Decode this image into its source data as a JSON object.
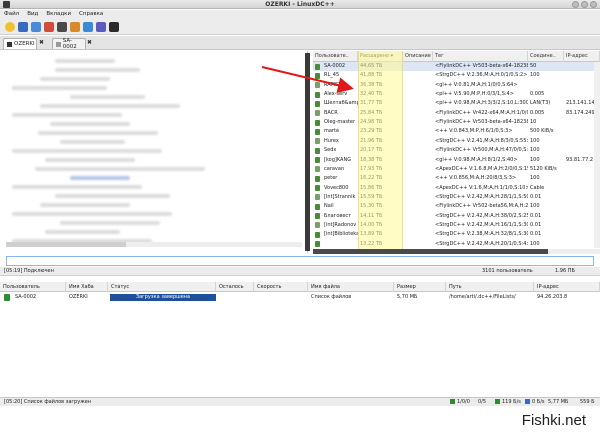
{
  "window": {
    "title": "OZERKI - LinuxDC++"
  },
  "menu": [
    "Файл",
    "Вид",
    "Вкладки",
    "Справка"
  ],
  "toolbar_icons": [
    "favorites-icon",
    "public-hubs-icon",
    "reconnect-icon",
    "settings-icon",
    "search-icon",
    "download-queue-icon",
    "finished-icon",
    "upload-icon",
    "quit-icon"
  ],
  "hub_tabs": [
    {
      "label": "OZERKI",
      "active": true
    },
    {
      "label": "SA-0002",
      "active": false
    }
  ],
  "users": {
    "columns": [
      "Пользовате..",
      "Расшарено ▾",
      "Описание",
      "Тег",
      "Соедине..",
      "IP-адрес"
    ],
    "rows": [
      {
        "nick": "SA-0002",
        "share": "44,65 ТБ",
        "desc": "",
        "tag": "<FlylinkDC++ Vr503-beta-x64-18238,M:A,H:1/0/0,S:5>",
        "conn": "50",
        "ip": ""
      },
      {
        "nick": "RL_45",
        "share": "41,88 ТБ",
        "desc": "",
        "tag": "<StrgDC++ V:2.36,M:A,H:0/1/0,S:2>",
        "conn": "100",
        "ip": ""
      },
      {
        "nick": "RAPIST",
        "share": "36,38 ТБ",
        "desc": "",
        "tag": "<gl++ V:0.81,M:A,H:1/0/0,S:64>",
        "conn": "",
        "ip": ""
      },
      {
        "nick": "Alex-serv",
        "share": "32,40 ТБ",
        "desc": "",
        "tag": "<pl++ V:5.90,M:P,H:0/3/1,S:4>",
        "conn": "0.005",
        "ip": ""
      },
      {
        "nick": "Шелтаб&amp;",
        "share": "31,77 ТБ",
        "desc": "",
        "tag": "<pl++ V:0.98,M:A,H:3/3/2,S:10,L:3000>",
        "conn": "LAN(T3)",
        "ip": "213.141.148.2"
      },
      {
        "nick": "BACR",
        "share": "25,84 ТБ",
        "desc": "",
        "tag": "<FlylinkDC++ Vr422-x64,M:A,H:1/0/0,S:2>",
        "conn": "0.005",
        "ip": "83.174.249.69"
      },
      {
        "nick": "Oleg-master",
        "share": "24,98 ТБ",
        "desc": "",
        "tag": "<FlylinkDC++ Vr503-beta-x64-18238,M:A,H:1/0/0,S:4>",
        "conn": "10",
        "ip": ""
      },
      {
        "nick": "marté",
        "share": "23,29 ТБ",
        "desc": "",
        "tag": "<++ V:0.843,M:P,H:6/1/0,S:3>",
        "conn": "500 KiB/s",
        "ip": ""
      },
      {
        "nick": "Hurex",
        "share": "21,96 ТБ",
        "desc": "",
        "tag": "<StrgDC++ V:2.41,M:A,H:8/3/0,S:55>",
        "conn": "100",
        "ip": ""
      },
      {
        "nick": "Sedx",
        "share": "20,17 ТБ",
        "desc": "",
        "tag": "<FlylinkDC++ Vr500,M:A,H:47/0/0,S:8>",
        "conn": "100",
        "ip": ""
      },
      {
        "nick": "[kog]KANG",
        "share": "18,38 ТБ",
        "desc": "",
        "tag": "<gl++ V:0.98,M:A,H:8/1/2,S:40>",
        "conn": "100",
        "ip": "93.81.77.2"
      },
      {
        "nick": "caravan",
        "share": "17,93 ТБ",
        "desc": "",
        "tag": "<ApexDC++ V:1.6.8,M:A,H:2/0/0,S:15>",
        "conn": "5120 KiB/s",
        "ip": ""
      },
      {
        "nick": "peter",
        "share": "16,22 ТБ",
        "desc": "",
        "tag": "<++ V:0.856,M:A,H:20/8/3,S:3>",
        "conn": "100",
        "ip": ""
      },
      {
        "nick": "Vovec800",
        "share": "15,86 ТБ",
        "desc": "",
        "tag": "<ApexDC++ V:1.6,M:A,H:1/1/0,S:10>",
        "conn": "Cable",
        "ip": ""
      },
      {
        "nick": "[Int]Strannik",
        "share": "15,59 ТБ",
        "desc": "",
        "tag": "<StrgDC++ V:2.42,M:A,H:28/1/1,S:50>",
        "conn": "0.01",
        "ip": ""
      },
      {
        "nick": "Nail",
        "share": "15,30 ТБ",
        "desc": "",
        "tag": "<FlylinkDC++ Vr502-beta56,M:A,H:22/0/0,S:5>",
        "conn": "100",
        "ip": ""
      },
      {
        "nick": "Благовест",
        "share": "14,11 ТБ",
        "desc": "",
        "tag": "<StrgDC++ V:2.42,M:A,H:38/0/2,S:25>",
        "conn": "0.01",
        "ip": ""
      },
      {
        "nick": "[int]Radonov",
        "share": "14,00 ТБ",
        "desc": "",
        "tag": "<StrgDC++ V:2.42,M:A,H:16/1/1,S:30>",
        "conn": "0.01",
        "ip": ""
      },
      {
        "nick": "[int]Biblioteka",
        "share": "13,89 ТБ",
        "desc": "",
        "tag": "<StrgDC++ V:2.38,M:A,H:32/8/1,S:30>",
        "conn": "0.01",
        "ip": ""
      },
      {
        "nick": "",
        "share": "13,22 ТБ",
        "desc": "",
        "tag": "<StrgDC++ V:2.42,M:A,H:20/1/0,S:4>",
        "conn": "100",
        "ip": ""
      }
    ]
  },
  "status": {
    "message": "[05:19] Подключен",
    "users_count": "3101 пользователь",
    "total_share": "1.96 ПБ"
  },
  "transfers": {
    "columns": [
      "Пользователь",
      "Имя Хаба",
      "Статус",
      "Осталось",
      "Скорость",
      "Имя файла",
      "Размер",
      "Путь",
      "IP-адрес"
    ],
    "rows": [
      {
        "user": "SA-0002",
        "hub": "OZERKI",
        "status": "Загрузка завершена",
        "remaining": "",
        "speed": "",
        "file": "Список файлов",
        "size": "5,70 МБ",
        "path": "/home/arti/.dc++/FileLists/",
        "ip": "94.26.203.8",
        "progress": 1.0
      }
    ]
  },
  "bottom": {
    "message": "[05:20] Список файлов загружен",
    "hubs": "1/0/0",
    "slots": "0/5",
    "down_speed": "119 Б/s",
    "up_speed": "0 Б/s",
    "down_total": "5,77 МБ",
    "up_total": "559 Б"
  },
  "watermark": "Fishki.net"
}
